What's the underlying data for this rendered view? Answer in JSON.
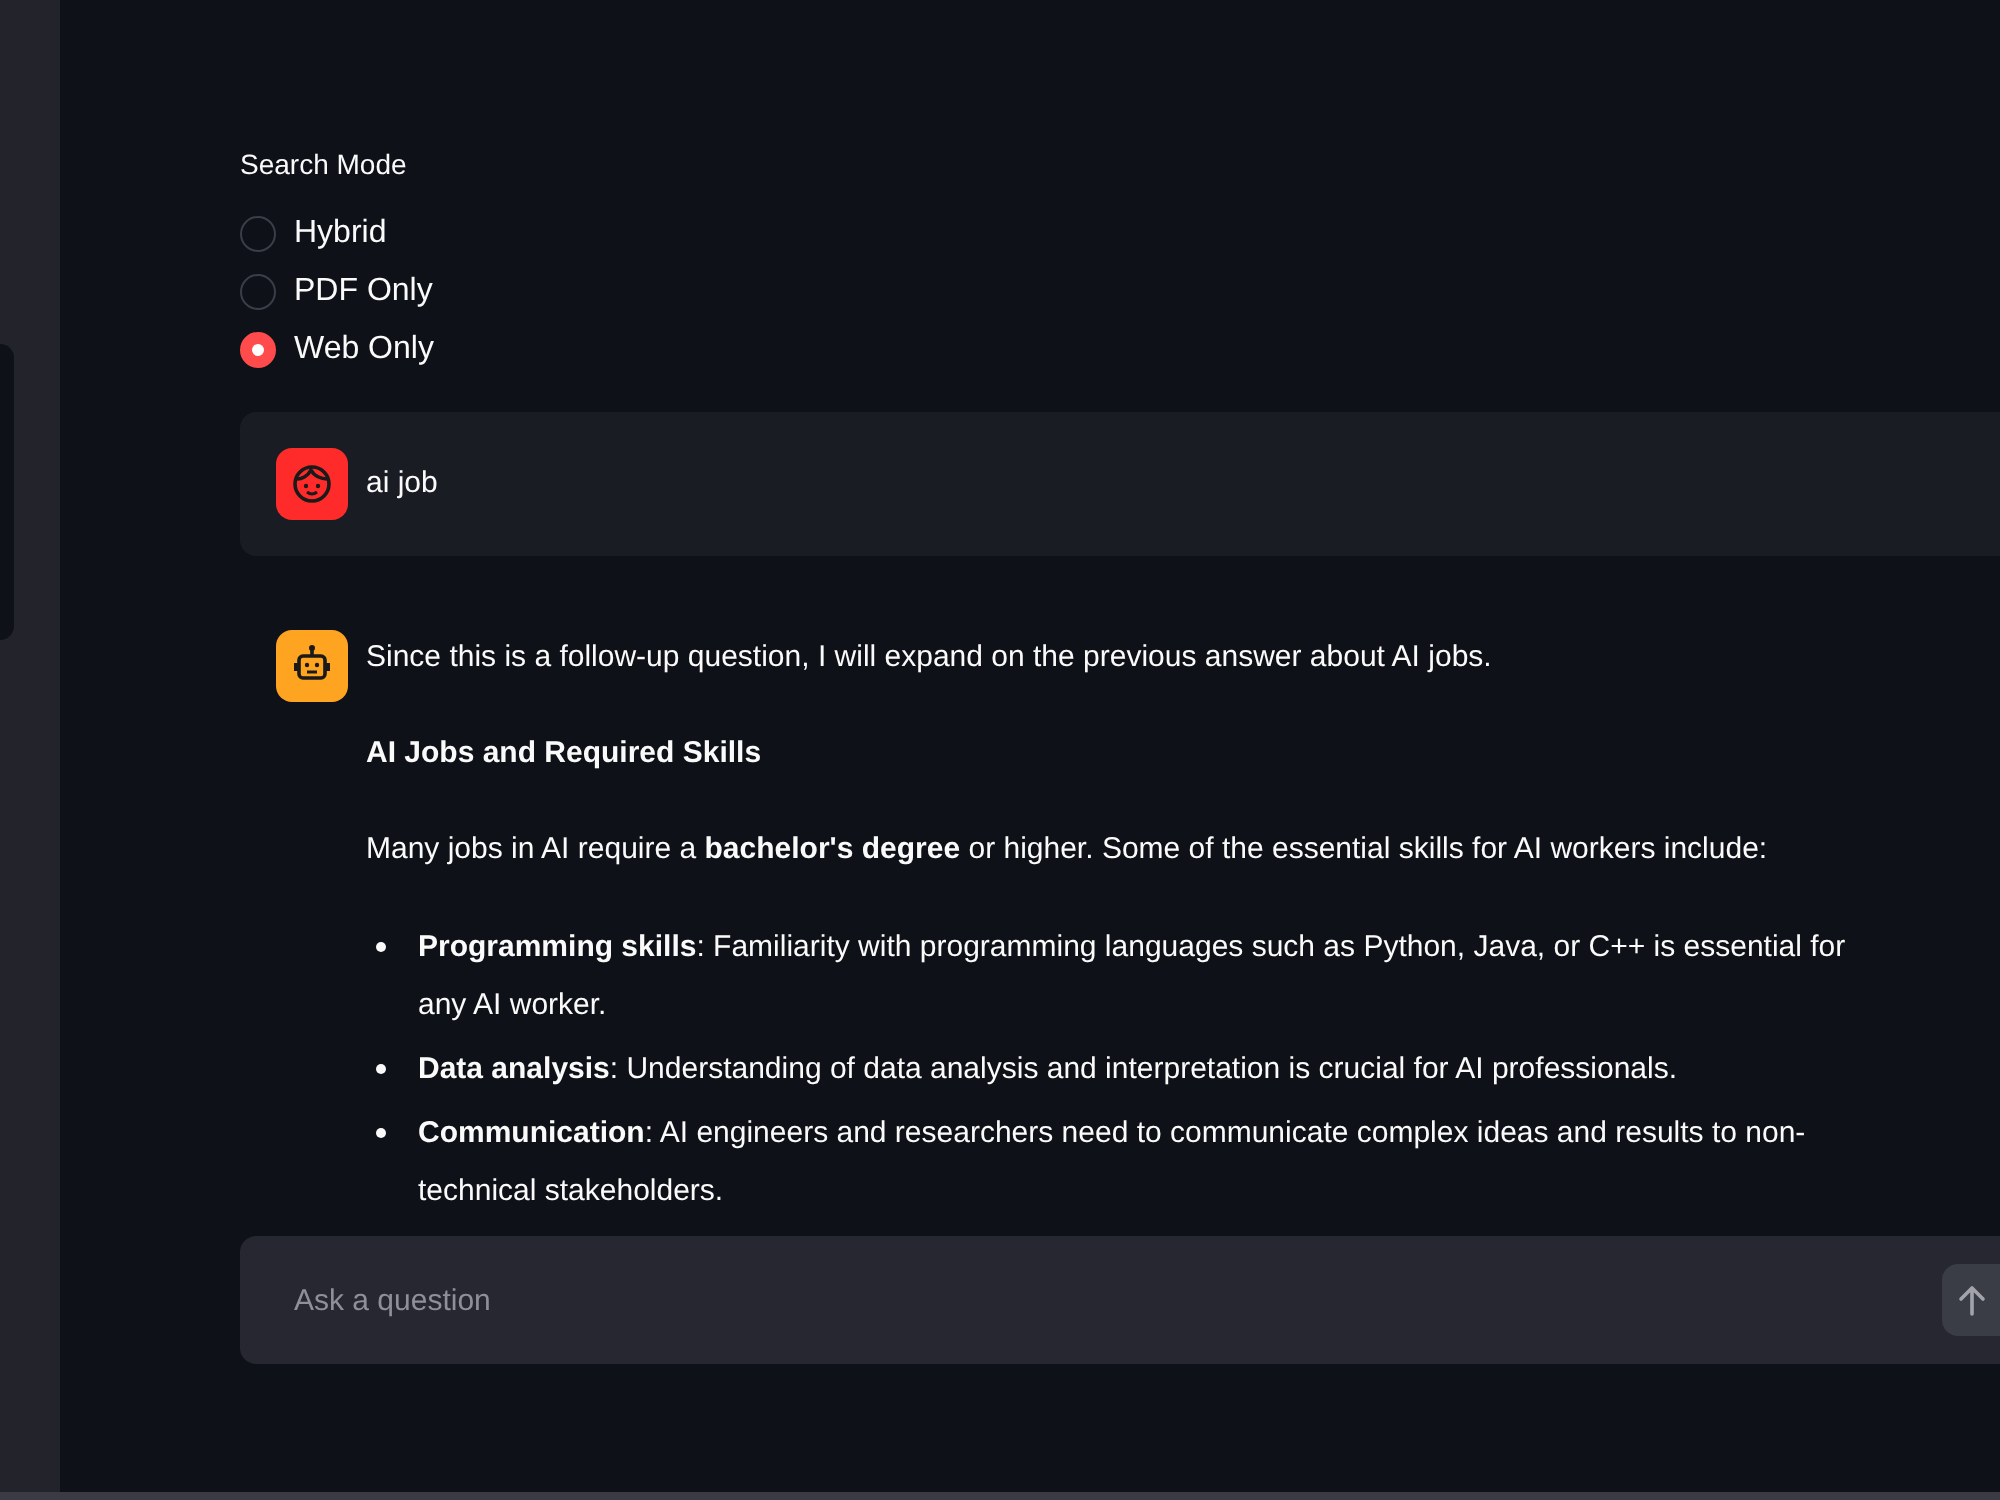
{
  "search_mode": {
    "label": "Search Mode",
    "options": [
      {
        "label": "Hybrid",
        "selected": false
      },
      {
        "label": "PDF Only",
        "selected": false
      },
      {
        "label": "Web Only",
        "selected": true
      }
    ]
  },
  "messages": [
    {
      "kind": "user",
      "content": [
        {
          "kind": "paragraph",
          "text": "ai job"
        }
      ]
    },
    {
      "kind": "assistant",
      "content": [
        {
          "kind": "paragraph",
          "text": "Since this is a follow-up question, I will expand on the previous answer about AI jobs."
        },
        {
          "kind": "heading",
          "text": "AI Jobs and Required Skills"
        },
        {
          "kind": "paragraph",
          "text": "Many jobs in AI require a **bachelor's degree** or higher. Some of the essential skills for AI workers include:"
        },
        {
          "kind": "bullets",
          "items": [
            "**Programming skills**: Familiarity with programming languages such as Python, Java, or C++ is essential for any AI worker.",
            "**Data analysis**: Understanding of data analysis and interpretation is crucial for AI professionals.",
            "**Communication**: AI engineers and researchers need to communicate complex ideas and results to non-technical stakeholders."
          ]
        }
      ]
    }
  ],
  "chat_input": {
    "placeholder": "Ask a question"
  }
}
